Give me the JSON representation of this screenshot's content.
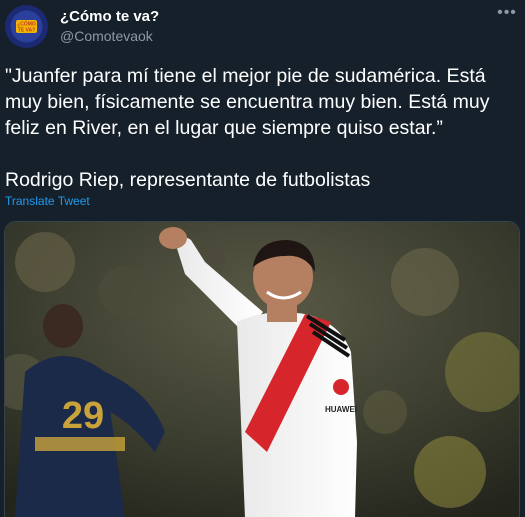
{
  "header": {
    "display_name": "¿Cómo te va?",
    "handle": "@Comotevaok",
    "avatar_text": "¿CÓMO TE VA?",
    "more_icon": "more-icon"
  },
  "tweet": {
    "quote": "\"Juanfer para mí tiene el mejor pie de sudamérica. Está muy bien, físicamente se encuentra muy bien. Está muy feliz en River, en el lugar que siempre quiso estar.”",
    "attribution": "Rodrigo Riep, representante de futbolistas",
    "translate_label": "Translate Tweet"
  },
  "media": {
    "player_back_number": "29",
    "sponsor_text": "HUAWEI"
  },
  "colors": {
    "background": "#15202b",
    "link": "#1d9bf0",
    "secondary_text": "#8b98a5"
  }
}
